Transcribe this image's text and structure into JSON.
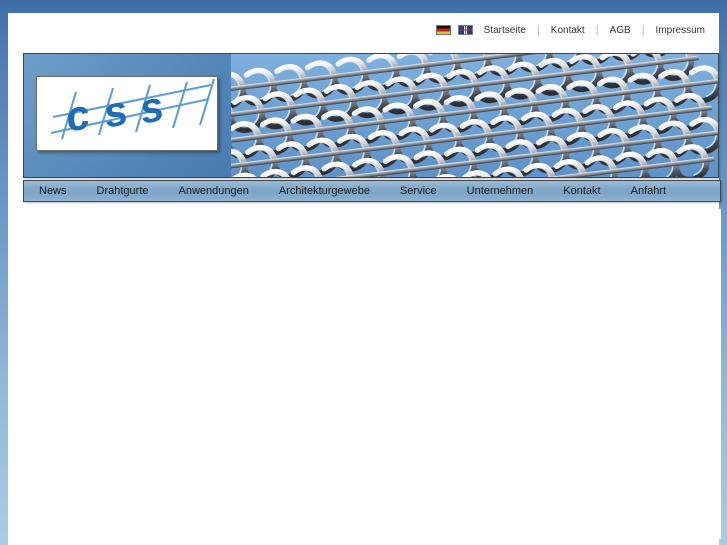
{
  "site": {
    "name": "CSS",
    "logo_text": "css",
    "logo_alt": "CSS company logo"
  },
  "colors": {
    "backdrop_top": "#3f6ea6",
    "backdrop_bottom": "#aacde3",
    "panel": "#ffffff",
    "nav_bar": "#7ba4c6",
    "border": "#41464d",
    "logo_blue": "#2a72b8",
    "text": "#1b1b1b"
  },
  "utility_nav": {
    "flags": [
      {
        "name": "flag-de-icon",
        "label": "Deutsch",
        "code": "de"
      },
      {
        "name": "flag-uk-icon",
        "label": "English",
        "code": "uk"
      }
    ],
    "links": [
      {
        "label": "Startseite"
      },
      {
        "label": "Kontakt"
      },
      {
        "label": "AGB"
      },
      {
        "label": "Impressum"
      }
    ],
    "separator": "|"
  },
  "header": {
    "banner_alt": "Spiralgeflecht Drahtgurt Nahaufnahme",
    "banner_bg": "#6b9ed2"
  },
  "main_nav": {
    "items": [
      {
        "label": "News"
      },
      {
        "label": "Drahtgurte"
      },
      {
        "label": "Anwendungen"
      },
      {
        "label": "Architekturgewebe"
      },
      {
        "label": "Service"
      },
      {
        "label": "Unternehmen"
      },
      {
        "label": "Kontakt"
      },
      {
        "label": "Anfahrt"
      }
    ]
  },
  "content": {
    "body_text": ""
  }
}
